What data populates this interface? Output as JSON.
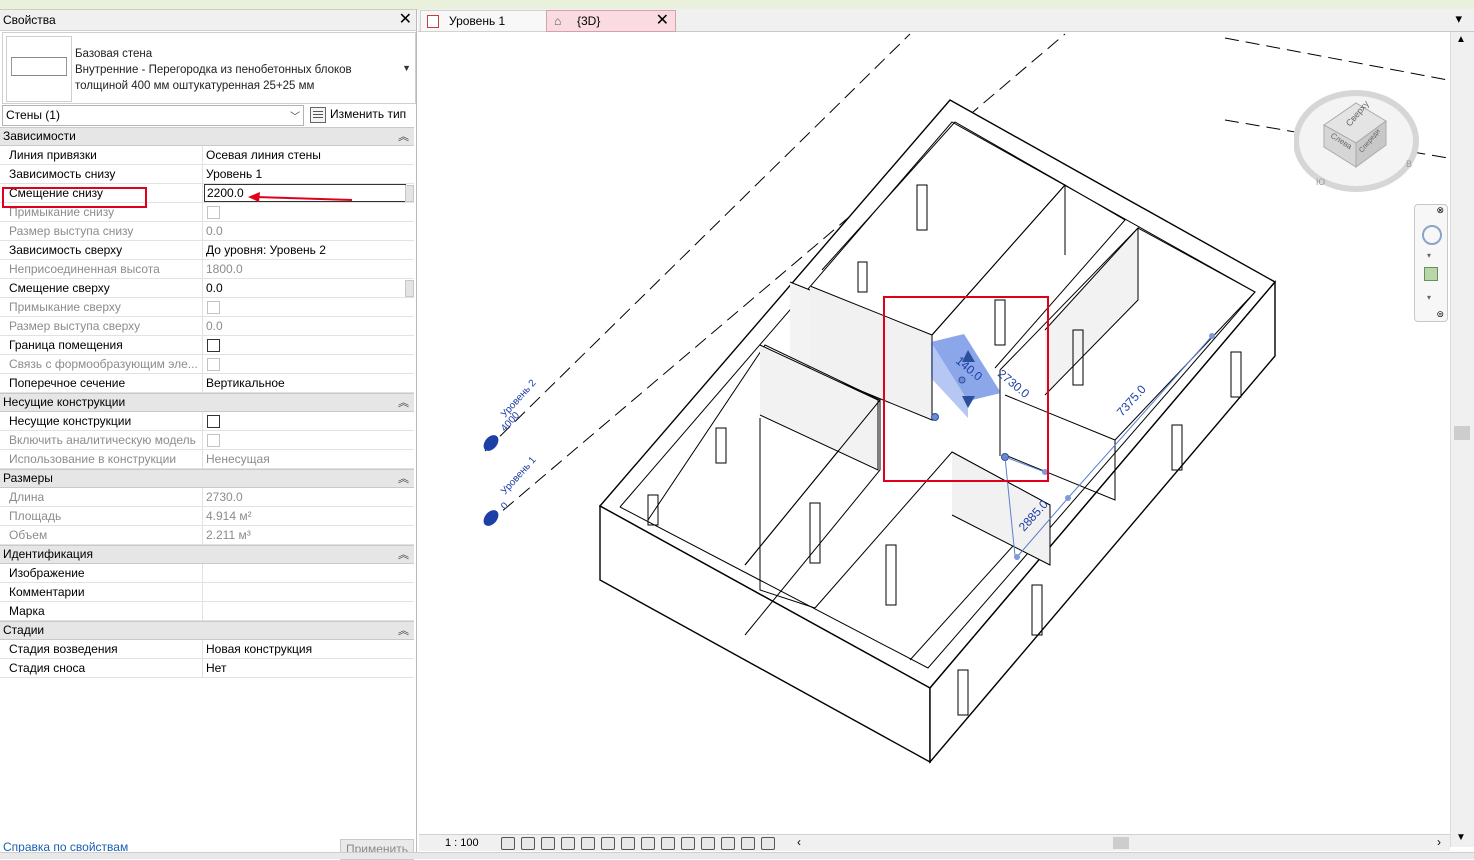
{
  "properties": {
    "title": "Свойства",
    "type_name": [
      "Базовая стена",
      "Внутренние - Перегородка из пенобетонных блоков",
      "толщиной 400 мм оштукатуренная 25+25 мм"
    ],
    "filter": "Стены (1)",
    "edit_type": "Изменить тип",
    "sections": [
      {
        "title": "Зависимости",
        "rows": [
          {
            "name": "Линия привязки",
            "value": "Осевая линия стены",
            "kind": "text"
          },
          {
            "name": "Зависимость снизу",
            "value": "Уровень 1",
            "kind": "text"
          },
          {
            "name": "Смещение снизу",
            "value": "2200.0",
            "kind": "input"
          },
          {
            "name": "Примыкание снизу",
            "value": "",
            "kind": "check",
            "disabled": true
          },
          {
            "name": "Размер выступа снизу",
            "value": "0.0",
            "kind": "text",
            "disabled": true
          },
          {
            "name": "Зависимость сверху",
            "value": "До уровня: Уровень 2",
            "kind": "text"
          },
          {
            "name": "Неприсоединенная высота",
            "value": "1800.0",
            "kind": "text",
            "disabled": true
          },
          {
            "name": "Смещение сверху",
            "value": "0.0",
            "kind": "text"
          },
          {
            "name": "Примыкание сверху",
            "value": "",
            "kind": "check",
            "disabled": true
          },
          {
            "name": "Размер выступа сверху",
            "value": "0.0",
            "kind": "text",
            "disabled": true
          },
          {
            "name": "Граница помещения",
            "value": "",
            "kind": "check"
          },
          {
            "name": "Связь с формообразующим эле...",
            "value": "",
            "kind": "check",
            "disabled": true
          },
          {
            "name": "Поперечное сечение",
            "value": "Вертикальное",
            "kind": "text"
          }
        ]
      },
      {
        "title": "Несущие конструкции",
        "rows": [
          {
            "name": "Несущие конструкции",
            "value": "",
            "kind": "check"
          },
          {
            "name": "Включить аналитическую модель",
            "value": "",
            "kind": "check",
            "disabled": true
          },
          {
            "name": "Использование в конструкции",
            "value": "Ненесущая",
            "kind": "text",
            "disabled": true
          }
        ]
      },
      {
        "title": "Размеры",
        "rows": [
          {
            "name": "Длина",
            "value": "2730.0",
            "kind": "text",
            "disabled": true
          },
          {
            "name": "Площадь",
            "value": "4.914 м²",
            "kind": "text",
            "disabled": true
          },
          {
            "name": "Объем",
            "value": "2.211 м³",
            "kind": "text",
            "disabled": true
          }
        ]
      },
      {
        "title": "Идентификация",
        "rows": [
          {
            "name": "Изображение",
            "value": "",
            "kind": "text"
          },
          {
            "name": "Комментарии",
            "value": "",
            "kind": "text"
          },
          {
            "name": "Марка",
            "value": "",
            "kind": "text"
          }
        ]
      },
      {
        "title": "Стадии",
        "rows": [
          {
            "name": "Стадия возведения",
            "value": "Новая конструкция",
            "kind": "text"
          },
          {
            "name": "Стадия сноса",
            "value": "Нет",
            "kind": "text"
          }
        ]
      }
    ],
    "help_link": "Справка по свойствам",
    "apply": "Применить"
  },
  "tabs": [
    {
      "label": "Уровень 1",
      "icon": "floor-plan-icon"
    },
    {
      "label": "{3D}",
      "icon": "3d-view-icon",
      "active": true
    }
  ],
  "view": {
    "levels": [
      {
        "name": "Уровень 2",
        "elevation": "4000"
      },
      {
        "name": "Уровень 1",
        "elevation": "0"
      }
    ],
    "dimensions": [
      "140.0",
      "2730.0",
      "7375.0",
      "2885.0"
    ],
    "viewcube": {
      "top": "Сверху",
      "left": "Слева",
      "front": "Спереди"
    }
  },
  "status": {
    "scale": "1 : 100"
  },
  "colors": {
    "highlight": "#e0001b",
    "selection": "#2b5fd9"
  }
}
